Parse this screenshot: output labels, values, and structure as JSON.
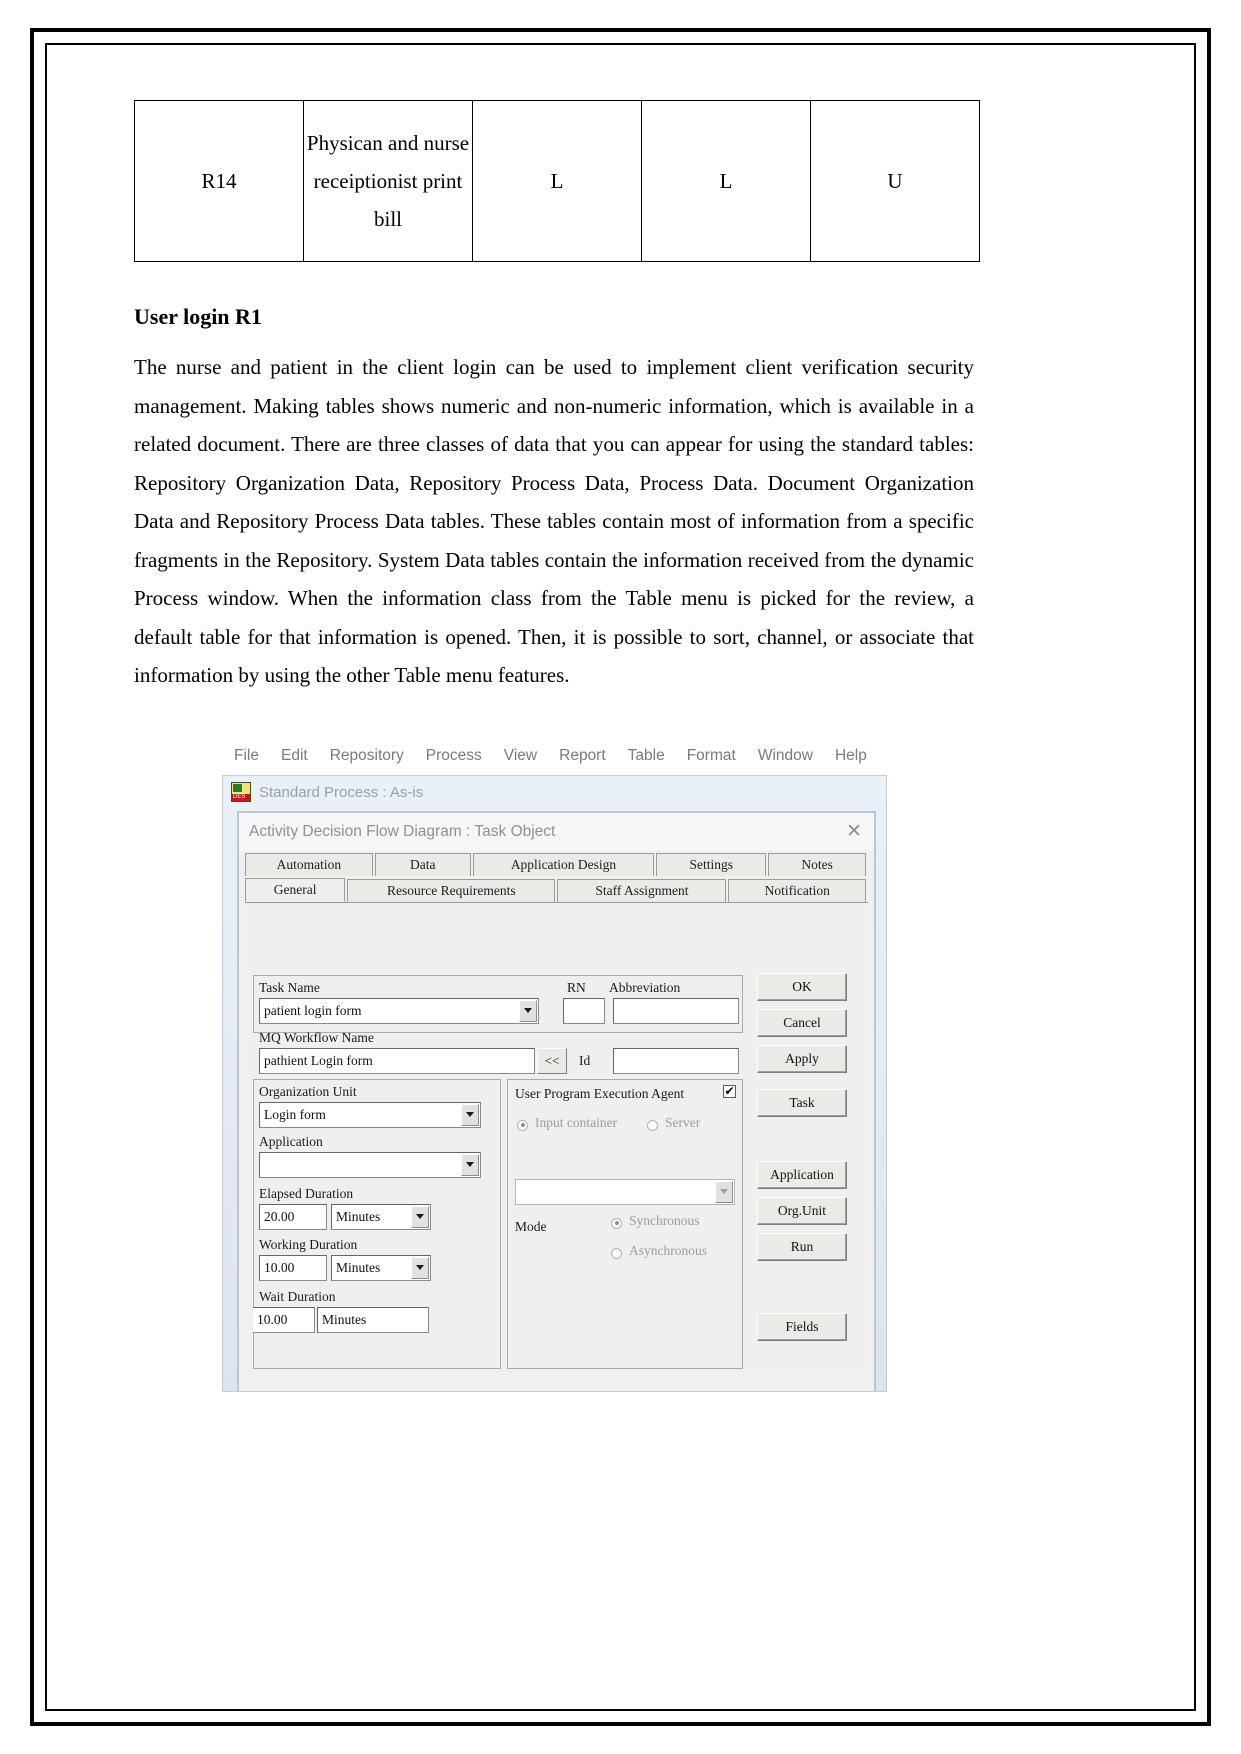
{
  "document": {
    "table": {
      "rows": [
        {
          "id": "R14",
          "description": "Physican and nurse receiptionist print bill",
          "c1": "L",
          "c2": "L",
          "c3": "U"
        }
      ]
    },
    "heading": "User login R1",
    "paragraph": "The nurse and patient in the client login can be used to implement client verification security management. Making tables shows numeric and non-numeric information, which is available in a related document. There are three classes of data that you can appear for using the standard tables: Repository Organization Data, Repository Process Data, Process Data. Document Organization Data and Repository Process Data tables. These tables contain most of information from a specific fragments in the Repository. System Data tables contain the information received from the dynamic Process window. When the information class from the Table menu is picked for the review, a default table for that information is opened. Then, it is possible to sort, channel, or associate that information by using the other Table menu features."
  },
  "app": {
    "menubar": [
      "File",
      "Edit",
      "Repository",
      "Process",
      "View",
      "Report",
      "Table",
      "Format",
      "Window",
      "Help"
    ],
    "mdi_title": "Standard Process : As-is",
    "dialog": {
      "title": "Activity Decision Flow Diagram : Task  Object",
      "close_label": "✕",
      "tabs_row1": [
        "Automation",
        "Data",
        "Application Design",
        "Settings",
        "Notes"
      ],
      "tabs_row2": [
        "General",
        "Resource Requirements",
        "Staff Assignment",
        "Notification"
      ],
      "active_tab": "General",
      "fields": {
        "task_name_label": "Task Name",
        "task_name_value": "patient login form",
        "rn_label": "RN",
        "rn_value": "",
        "abbreviation_label": "Abbreviation",
        "abbreviation_value": "",
        "mq_workflow_label": "MQ Workflow Name",
        "mq_workflow_value": "pathient Login form",
        "mq_prev_button": "<<",
        "id_label": "Id",
        "id_value": "",
        "org_unit_label": "Organization Unit",
        "org_unit_value": "Login form",
        "application_label": "Application",
        "application_value": "",
        "elapsed_duration_label": "Elapsed Duration",
        "elapsed_duration_value": "20.00",
        "elapsed_duration_unit": "Minutes",
        "working_duration_label": "Working Duration",
        "working_duration_value": "10.00",
        "working_duration_unit": "Minutes",
        "wait_duration_label": "Wait Duration",
        "wait_duration_value": "10.00",
        "wait_duration_unit": "Minutes"
      },
      "agent_panel": {
        "title": "User Program Execution Agent",
        "checkbox_mark": "✔",
        "radio_input_container": "Input container",
        "radio_server": "Server",
        "program_value": "",
        "mode_label": "Mode",
        "radio_synchronous": "Synchronous",
        "radio_asynchronous": "Asynchronous"
      },
      "buttons": [
        "OK",
        "Cancel",
        "Apply",
        "Task",
        "Application",
        "Org.Unit",
        "Run",
        "Fields"
      ]
    }
  }
}
